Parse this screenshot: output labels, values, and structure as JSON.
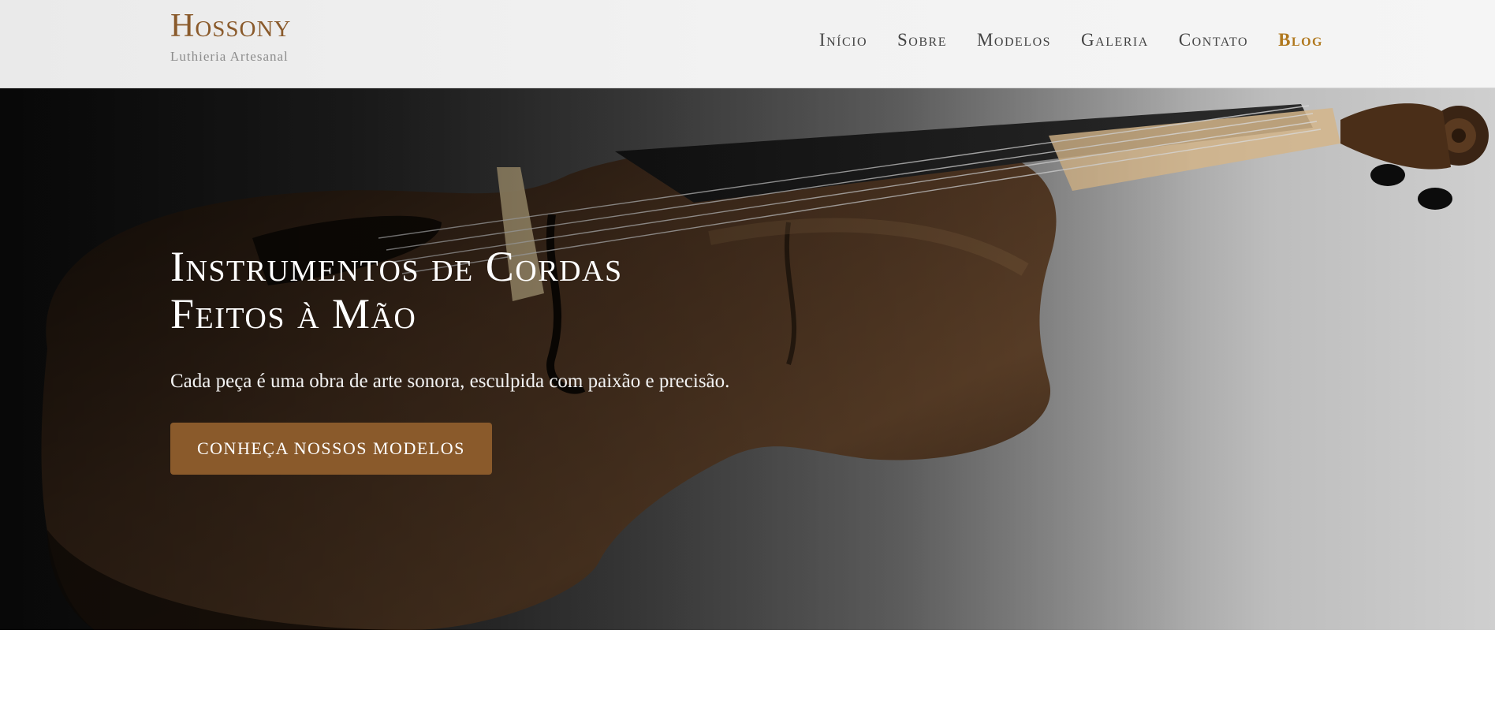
{
  "brand": {
    "name": "Hossony",
    "tagline": "Luthieria Artesanal"
  },
  "nav": {
    "items": [
      {
        "label": "Início"
      },
      {
        "label": "Sobre"
      },
      {
        "label": "Modelos"
      },
      {
        "label": "Galeria"
      },
      {
        "label": "Contato"
      },
      {
        "label": "Blog",
        "active": true
      }
    ]
  },
  "hero": {
    "title_line1": "Instrumentos de Cordas",
    "title_line2": "Feitos à Mão",
    "subtitle": "Cada peça é uma obra de arte sonora, esculpida com paixão e precisão.",
    "cta_label": "Conheça Nossos Modelos",
    "image_icon": "violin-photo"
  },
  "colors": {
    "brand": "#8a5a2b",
    "active_nav": "#b0781e",
    "button": "#8a5a2b"
  }
}
